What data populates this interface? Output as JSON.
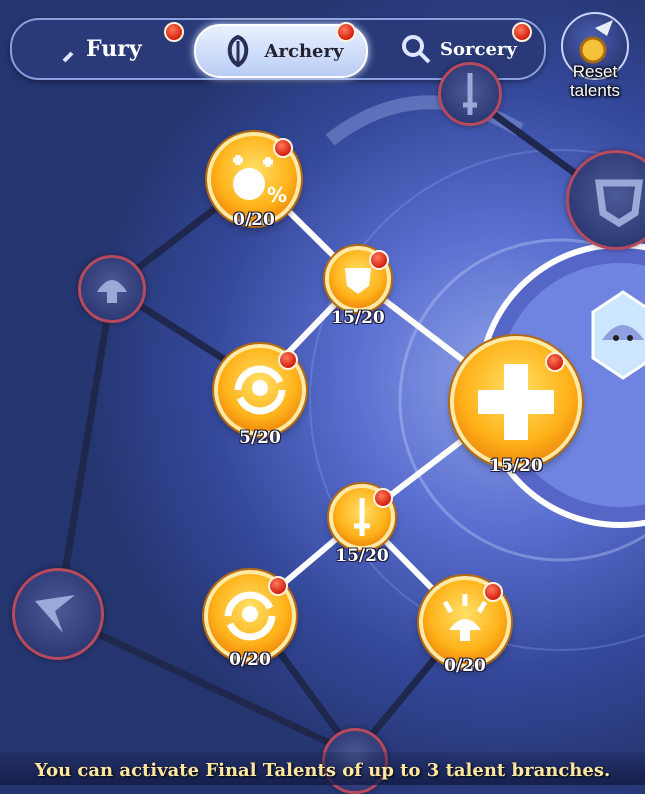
{
  "tabs": {
    "fury": {
      "label": "Fury"
    },
    "archery": {
      "label": "Archery"
    },
    "sorcery": {
      "label": "Sorcery"
    }
  },
  "reset": {
    "label_line1": "Reset",
    "label_line2": "talents"
  },
  "nodes": {
    "top_left": {
      "count": "0/20"
    },
    "shield_small": {
      "count": "15/20"
    },
    "spiral_mid": {
      "count": "5/20"
    },
    "big_plus": {
      "count": "15/20"
    },
    "sword_small": {
      "count": "15/20"
    },
    "spiral_bottom": {
      "count": "0/20"
    },
    "mushroom_bottom": {
      "count": "0/20"
    }
  },
  "banner": {
    "text": "You can activate Final Talents of up to 3 talent branches."
  },
  "colors": {
    "gold": "#ffb21a",
    "notification": "#d32010",
    "locked_border": "#b7495c",
    "banner_text": "#ffe7a0"
  }
}
